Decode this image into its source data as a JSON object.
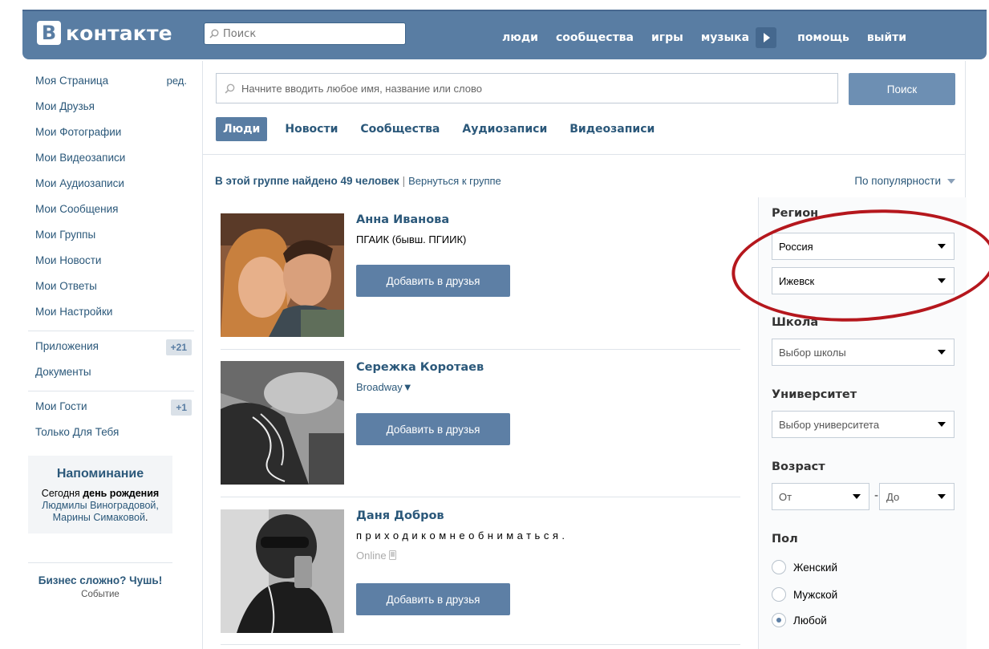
{
  "header": {
    "logo_letter": "В",
    "logo_text": "контакте",
    "search_placeholder": "Поиск",
    "nav": [
      "люди",
      "сообщества",
      "игры",
      "музыка",
      "помощь",
      "выйти"
    ]
  },
  "sidebar": {
    "edit_label": "ред.",
    "items": [
      {
        "label": "Моя Страница"
      },
      {
        "label": "Мои Друзья"
      },
      {
        "label": "Мои Фотографии"
      },
      {
        "label": "Мои Видеозаписи"
      },
      {
        "label": "Мои Аудиозаписи"
      },
      {
        "label": "Мои Сообщения"
      },
      {
        "label": "Мои Группы"
      },
      {
        "label": "Мои Новости"
      },
      {
        "label": "Мои Ответы"
      },
      {
        "label": "Мои Настройки"
      },
      {
        "label": "Приложения",
        "count": "+21"
      },
      {
        "label": "Документы"
      },
      {
        "label": "Мои Гости",
        "count": "+1"
      },
      {
        "label": "Только Для Тебя"
      }
    ],
    "reminder": {
      "title": "Напоминание",
      "line_prefix": "Сегодня",
      "line_bold": "день рождения",
      "names": "Людмилы Виноградовой, Марины Симаковой",
      "end": "."
    },
    "ad": {
      "title": "Бизнес сложно? Чушь!",
      "subtitle": "Событие"
    }
  },
  "search": {
    "placeholder": "Начните вводить любое имя, название или слово",
    "button": "Поиск"
  },
  "tabs": [
    "Люди",
    "Новости",
    "Сообщества",
    "Аудиозаписи",
    "Видеозаписи"
  ],
  "summary": {
    "found": "В этой группе найдено 49 человек",
    "separator": "|",
    "back": "Вернуться к группе",
    "sort": "По популярности"
  },
  "results": [
    {
      "name": "Анна Иванова",
      "sub": "ПГАИК (бывш. ПГИИК)",
      "button": "Добавить в друзья"
    },
    {
      "name": "Сережка Коротаев",
      "sub": "Broadway▼",
      "button": "Добавить в друзья"
    },
    {
      "name": "Даня Добров",
      "sub": "приходикомнеобниматься.",
      "online": "Online",
      "button": "Добавить в друзья"
    }
  ],
  "filters": {
    "region_label": "Регион",
    "country": "Россия",
    "city": "Ижевск",
    "school_label": "Школа",
    "school_placeholder": "Выбор школы",
    "university_label": "Университет",
    "university_placeholder": "Выбор университета",
    "age_label": "Возраст",
    "age_from": "От",
    "age_dash": "-",
    "age_to": "До",
    "sex_label": "Пол",
    "sex_options": [
      {
        "label": "Женский",
        "selected": false
      },
      {
        "label": "Мужской",
        "selected": false
      },
      {
        "label": "Любой",
        "selected": true
      }
    ]
  },
  "annotation": {
    "color": "#b5171d"
  }
}
